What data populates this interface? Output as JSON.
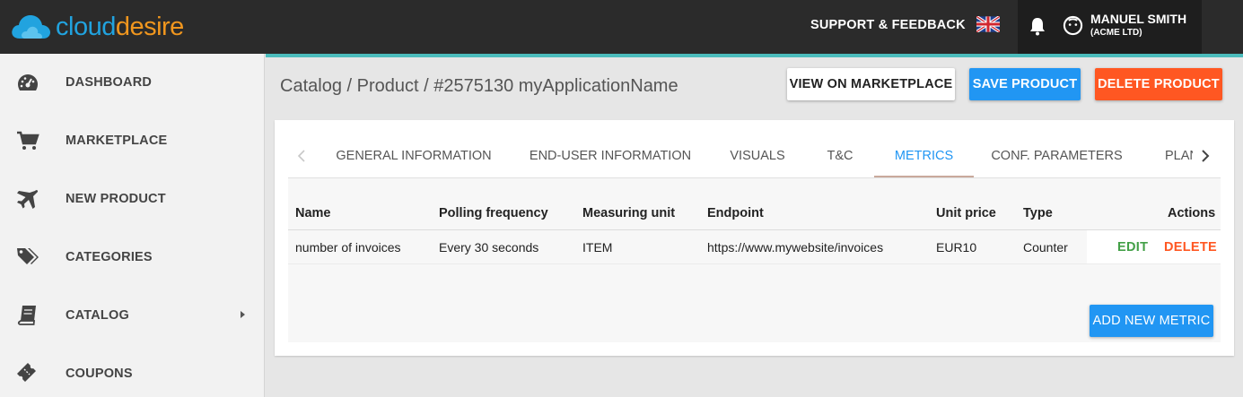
{
  "topbar": {
    "logo": {
      "part1": "cloud",
      "part2": "desire"
    },
    "support_label": "SUPPORT & FEEDBACK",
    "flag_icon": "uk-flag-icon",
    "bell_icon": "bell-icon",
    "user": {
      "name": "MANUEL SMITH",
      "company": "(ACME LTD)"
    }
  },
  "sidebar": {
    "items": [
      {
        "label": "DASHBOARD",
        "icon": "dashboard-gauge-icon"
      },
      {
        "label": "MARKETPLACE",
        "icon": "cart-icon"
      },
      {
        "label": "NEW PRODUCT",
        "icon": "airplane-icon"
      },
      {
        "label": "CATEGORIES",
        "icon": "tags-icon"
      },
      {
        "label": "CATALOG",
        "icon": "book-icon",
        "has_submenu": true
      },
      {
        "label": "COUPONS",
        "icon": "ticket-icon"
      }
    ]
  },
  "header": {
    "breadcrumb": "Catalog / Product / #2575130 myApplicationName",
    "view_label": "VIEW ON MARKETPLACE",
    "save_label": "SAVE PRODUCT",
    "delete_label": "DELETE PRODUCT"
  },
  "tabs": [
    {
      "label": "GENERAL INFORMATION",
      "active": false
    },
    {
      "label": "END-USER INFORMATION",
      "active": false
    },
    {
      "label": "VISUALS",
      "active": false
    },
    {
      "label": "T&C",
      "active": false
    },
    {
      "label": "METRICS",
      "active": true
    },
    {
      "label": "CONF. PARAMETERS",
      "active": false
    },
    {
      "label": "PLANS",
      "active": false
    }
  ],
  "table": {
    "columns": [
      "Name",
      "Polling frequency",
      "Measuring unit",
      "Endpoint",
      "Unit price",
      "Type",
      "Actions"
    ],
    "rows": [
      {
        "name": "number of invoices",
        "polling": "Every 30 seconds",
        "unit": "ITEM",
        "endpoint": "https://www.mywebsite/invoices",
        "price": "EUR10",
        "type": "Counter",
        "edit_label": "EDIT",
        "delete_label": "DELETE"
      }
    ],
    "add_label": "ADD NEW METRIC"
  },
  "colors": {
    "topbar": "#2b2b2b",
    "accent_blue": "#2196f3",
    "accent_orange": "#ff5722",
    "edit_green": "#43a047",
    "teal_line": "#4bbcbc",
    "logo_blue": "#21a3df",
    "logo_orange": "#f0961e"
  }
}
